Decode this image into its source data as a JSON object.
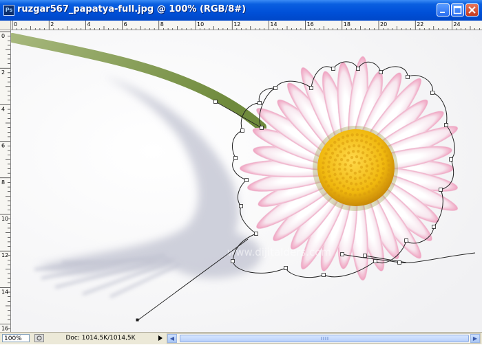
{
  "window": {
    "title": "ruzgar567_papatya-full.jpg @ 100% (RGB/8#)",
    "app_icon": "Ps",
    "controls": [
      "minimize",
      "maximize",
      "close"
    ]
  },
  "ruler": {
    "top_labels": [
      "0",
      "2",
      "4",
      "6",
      "8",
      "10",
      "12",
      "14",
      "16",
      "18",
      "20",
      "22",
      "24"
    ],
    "left_labels": [
      "0",
      "2",
      "4",
      "6",
      "8",
      "10",
      "12",
      "14",
      "16"
    ]
  },
  "canvas": {
    "watermark": "www.dijitalders.com"
  },
  "status": {
    "zoom": "100%",
    "doc": "Doc: 1014,5K/1014,5K",
    "play_icon": "play-icon"
  },
  "colors": {
    "titlebar": "#0050d8",
    "petal": "#f3c6d8",
    "center": "#f2c21c",
    "stem": "#8aa45a"
  }
}
